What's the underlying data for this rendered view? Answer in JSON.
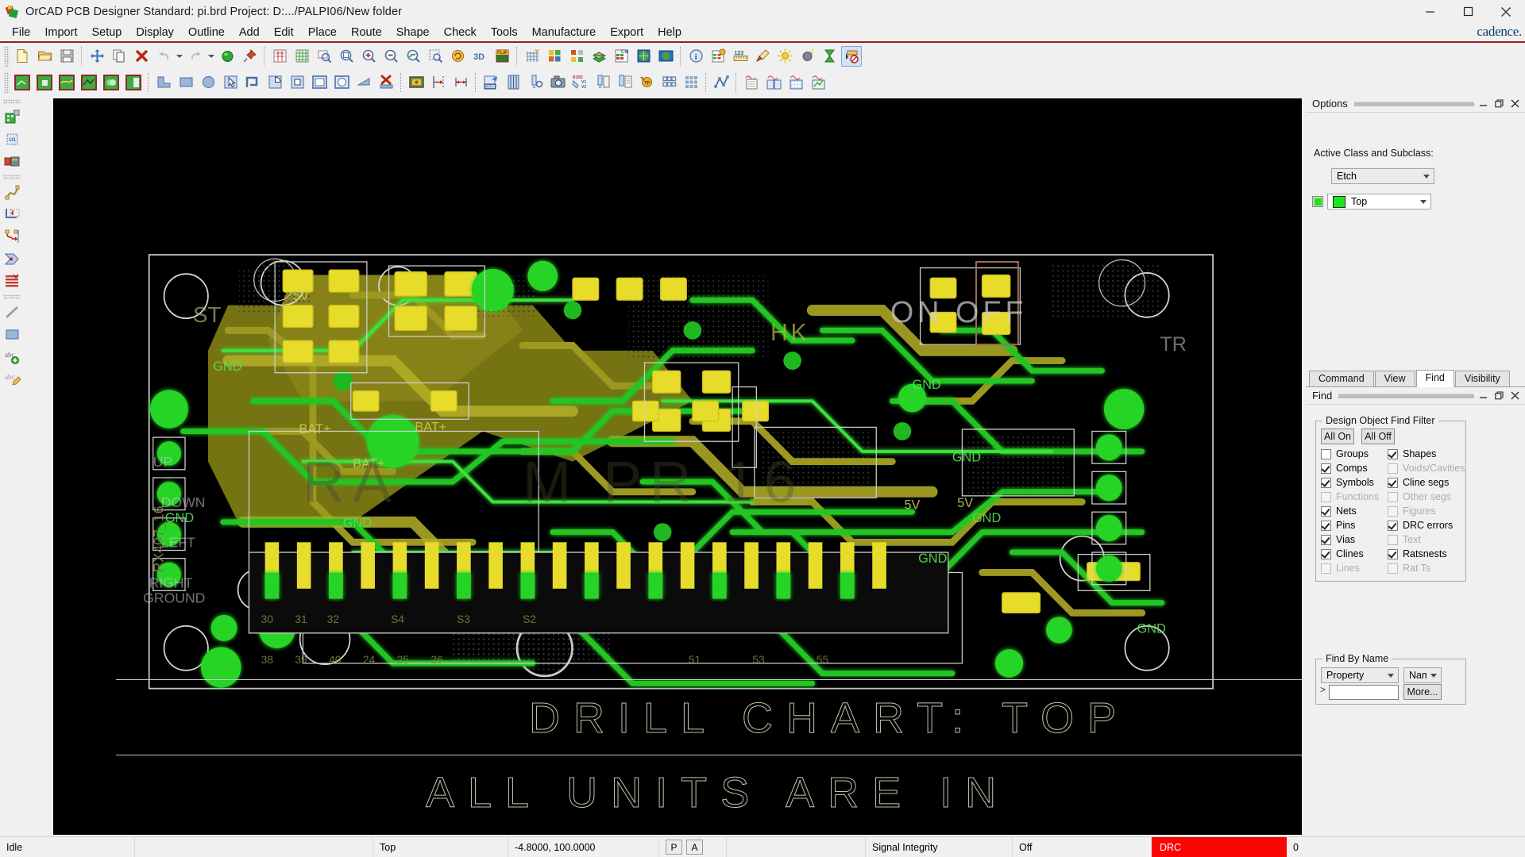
{
  "window": {
    "title": "OrCAD PCB Designer Standard: pi.brd  Project: D:.../PALPI06/New folder",
    "app_icon": "orcad-icon",
    "minimize": "minimize-icon",
    "maximize": "maximize-icon",
    "close": "close-icon"
  },
  "brand": {
    "name": "cadence",
    "dot": "."
  },
  "menubar": {
    "items": [
      {
        "label": "File"
      },
      {
        "label": "Import"
      },
      {
        "label": "Setup"
      },
      {
        "label": "Display"
      },
      {
        "label": "Outline"
      },
      {
        "label": "Add"
      },
      {
        "label": "Edit"
      },
      {
        "label": "Place"
      },
      {
        "label": "Route"
      },
      {
        "label": "Shape"
      },
      {
        "label": "Check"
      },
      {
        "label": "Tools"
      },
      {
        "label": "Manufacture"
      },
      {
        "label": "Export"
      },
      {
        "label": "Help"
      }
    ]
  },
  "toolbar_top": {
    "groups": [
      {
        "buttons": [
          {
            "name": "new-file-icon",
            "enabled": true
          },
          {
            "name": "open-file-icon",
            "enabled": true
          },
          {
            "name": "save-icon",
            "enabled": true
          }
        ]
      },
      {
        "buttons": [
          {
            "name": "move-icon",
            "enabled": true
          },
          {
            "name": "copy-icon",
            "enabled": true
          },
          {
            "name": "delete-icon",
            "enabled": true
          },
          {
            "name": "undo-icon",
            "enabled": false
          },
          {
            "name": "undo-dropdown-caret-icon",
            "enabled": false
          },
          {
            "name": "redo-icon",
            "enabled": false
          },
          {
            "name": "redo-dropdown-caret-icon",
            "enabled": false
          },
          {
            "name": "net-highlight-icon",
            "enabled": true
          },
          {
            "name": "pin-icon",
            "enabled": true
          }
        ]
      },
      {
        "buttons": [
          {
            "name": "display-color-icon",
            "enabled": true
          },
          {
            "name": "grid-toggle-icon",
            "enabled": true
          },
          {
            "name": "zoom-fit-icon",
            "enabled": true
          },
          {
            "name": "zoom-previous-icon",
            "enabled": true
          },
          {
            "name": "zoom-by-points-icon",
            "enabled": true
          },
          {
            "name": "zoom-world-icon",
            "enabled": true
          },
          {
            "name": "zoom-in-icon",
            "enabled": true
          },
          {
            "name": "zoom-out-icon",
            "enabled": true
          },
          {
            "name": "zoom-center-icon",
            "enabled": true
          },
          {
            "name": "zoom-selection-icon",
            "enabled": true
          },
          {
            "name": "redraw-icon",
            "enabled": true
          },
          {
            "name": "view-3d-icon",
            "enabled": true
          },
          {
            "name": "flip-design-icon",
            "enabled": true
          }
        ]
      },
      {
        "buttons": [
          {
            "name": "grid-settings-icon",
            "enabled": true
          },
          {
            "name": "color-palette-icon",
            "enabled": true
          },
          {
            "name": "color-visibility-icon",
            "enabled": true
          },
          {
            "name": "subclass-stackup-icon",
            "enabled": true
          },
          {
            "name": "constraint-manager-icon",
            "enabled": true
          },
          {
            "name": "dfa-icon",
            "enabled": true
          },
          {
            "name": "global-view-icon",
            "enabled": true
          }
        ]
      },
      {
        "buttons": [
          {
            "name": "show-element-info-icon",
            "enabled": true
          },
          {
            "name": "property-edit-icon",
            "enabled": true
          },
          {
            "name": "measure-icon",
            "enabled": true
          },
          {
            "name": "highlight-brush-icon",
            "enabled": true
          },
          {
            "name": "light-on-icon",
            "enabled": true
          },
          {
            "name": "light-off-icon",
            "enabled": true
          },
          {
            "name": "hourglass-icon",
            "enabled": true
          },
          {
            "name": "unselect-all-icon",
            "enabled": true,
            "active": true
          }
        ]
      }
    ]
  },
  "toolbar_second": {
    "groups": [
      {
        "buttons": [
          {
            "name": "shape-add-rect-icon"
          },
          {
            "name": "shape-add-poly-icon"
          },
          {
            "name": "shape-edit-boundary-icon"
          },
          {
            "name": "shape-change-icon"
          },
          {
            "name": "shape-merge-icon"
          },
          {
            "name": "shape-delete-island-icon"
          }
        ]
      },
      {
        "buttons": [
          {
            "name": "draw-line-icon"
          },
          {
            "name": "draw-rectangle-icon"
          },
          {
            "name": "draw-circle-icon"
          },
          {
            "name": "draw-pick-icon"
          },
          {
            "name": "draw-path-icon"
          },
          {
            "name": "draw-arc-icon"
          },
          {
            "name": "draw-square-icon"
          },
          {
            "name": "draw-filled-rect-icon"
          },
          {
            "name": "draw-filled-circle-icon"
          },
          {
            "name": "draw-shape-fill-icon"
          },
          {
            "name": "draw-delete-icon"
          }
        ]
      },
      {
        "buttons": [
          {
            "name": "board-geometry-icon"
          },
          {
            "name": "dimension-single-icon"
          },
          {
            "name": "dimension-linear-icon"
          }
        ]
      },
      {
        "buttons": [
          {
            "name": "odb-export-icon"
          },
          {
            "name": "artwork-film-icon"
          },
          {
            "name": "drill-legend-icon"
          },
          {
            "name": "screen-capture-icon"
          },
          {
            "name": "silkscreen-icon"
          },
          {
            "name": "ncdrill-icon"
          },
          {
            "name": "report-icon"
          },
          {
            "name": "testprep-icon"
          },
          {
            "name": "pad-array-icon"
          },
          {
            "name": "pad-grid-icon"
          }
        ]
      },
      {
        "buttons": [
          {
            "name": "signal-path-icon"
          }
        ]
      },
      {
        "buttons": [
          {
            "name": "si-analysis-doc-icon"
          },
          {
            "name": "si-library-icon"
          },
          {
            "name": "si-model-icon"
          },
          {
            "name": "si-sim-icon"
          }
        ]
      }
    ]
  },
  "toolbar_left": {
    "groups": [
      {
        "buttons": [
          {
            "name": "place-manual-icon"
          },
          {
            "name": "place-component-icon"
          },
          {
            "name": "quickplace-icon"
          }
        ]
      },
      {
        "buttons": [
          {
            "name": "add-connect-icon"
          },
          {
            "name": "slide-icon"
          },
          {
            "name": "delay-tune-icon"
          },
          {
            "name": "custom-smooth-icon"
          },
          {
            "name": "auto-route-icon"
          }
        ]
      },
      {
        "buttons": [
          {
            "name": "add-line-icon"
          },
          {
            "name": "add-rect-icon"
          },
          {
            "name": "add-text-icon"
          },
          {
            "name": "edit-text-icon"
          }
        ]
      }
    ]
  },
  "options_panel": {
    "title": "Options",
    "minimize": "minimize-icon",
    "restore": "restore-icon",
    "close": "close-icon",
    "section_label": "Active Class and Subclass:",
    "class_value": "Etch",
    "subclass_value": "Top",
    "subclass_color": "#17e817",
    "visibility_swatch_color": "#17e817"
  },
  "dock_tabs": {
    "items": [
      {
        "label": "Command",
        "selected": false
      },
      {
        "label": "View",
        "selected": false
      },
      {
        "label": "Find",
        "selected": true
      },
      {
        "label": "Visibility",
        "selected": false
      }
    ]
  },
  "find_panel": {
    "title": "Find",
    "minimize": "minimize-icon",
    "restore": "restore-icon",
    "close": "close-icon",
    "filter_group_label": "Design Object Find Filter",
    "all_on_label": "All On",
    "all_off_label": "All Off",
    "filters_left": [
      {
        "label": "Groups",
        "checked": false,
        "enabled": true
      },
      {
        "label": "Comps",
        "checked": true,
        "enabled": true
      },
      {
        "label": "Symbols",
        "checked": true,
        "enabled": true
      },
      {
        "label": "Functions",
        "checked": false,
        "enabled": false
      },
      {
        "label": "Nets",
        "checked": true,
        "enabled": true
      },
      {
        "label": "Pins",
        "checked": true,
        "enabled": true
      },
      {
        "label": "Vias",
        "checked": true,
        "enabled": true
      },
      {
        "label": "Clines",
        "checked": true,
        "enabled": true
      },
      {
        "label": "Lines",
        "checked": false,
        "enabled": false
      }
    ],
    "filters_right": [
      {
        "label": "Shapes",
        "checked": true,
        "enabled": true
      },
      {
        "label": "Voids/Cavities",
        "checked": false,
        "enabled": false
      },
      {
        "label": "Cline segs",
        "checked": true,
        "enabled": true
      },
      {
        "label": "Other segs",
        "checked": false,
        "enabled": false
      },
      {
        "label": "Figures",
        "checked": false,
        "enabled": false
      },
      {
        "label": "DRC errors",
        "checked": true,
        "enabled": true
      },
      {
        "label": "Text",
        "checked": false,
        "enabled": false
      },
      {
        "label": "Ratsnests",
        "checked": true,
        "enabled": true
      },
      {
        "label": "Rat Ts",
        "checked": false,
        "enabled": false
      }
    ],
    "find_by_name_label": "Find By Name",
    "find_type_value": "Property",
    "find_scope_value": "Name",
    "expand_marker": ">",
    "name_input_value": "",
    "more_label": "More..."
  },
  "canvas": {
    "drill_chart_text": "DRILL CHART: TOP",
    "units_text": "ALL UNITS ARE IN",
    "silkscreen": [
      {
        "text": "ON OFF"
      },
      {
        "text": "HK"
      },
      {
        "text": "GND"
      },
      {
        "text": "5V"
      },
      {
        "text": "BAT+"
      },
      {
        "text": "UP"
      },
      {
        "text": "DOWN"
      },
      {
        "text": "LEFT"
      },
      {
        "text": "RIGHT"
      },
      {
        "text": "GROUND"
      }
    ]
  },
  "statusbar": {
    "state": "Idle",
    "progress_color": "#17e817",
    "active_layer": "Top",
    "coordinates": "-4.8000, 100.0000",
    "mode_p": "P",
    "mode_a": "A",
    "signal_integrity_label": "Signal Integrity",
    "signal_integrity_value": "Off",
    "drc_label": "DRC",
    "drc_count": "0"
  }
}
